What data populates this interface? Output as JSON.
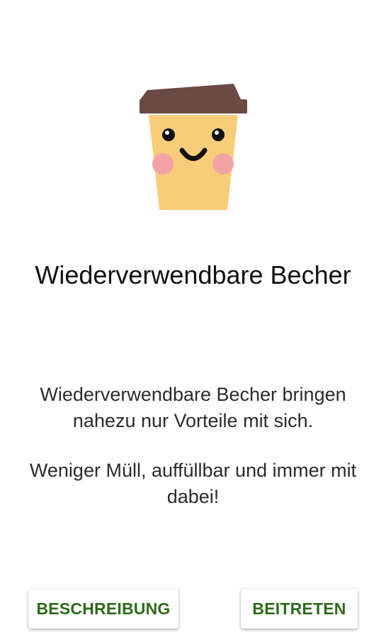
{
  "illustration": {
    "icon": "coffee-cup-face-icon",
    "colors": {
      "lid": "#6b4a43",
      "cup": "#f7cd7a",
      "cheeks": "#f4a3a5",
      "face": "#111111"
    }
  },
  "title": "Wiederverwendbare Becher",
  "description": {
    "paragraph1": "Wiederverwendbare Becher bringen nahezu nur Vorteile mit sich.",
    "paragraph2": "Weniger Müll, auffüllbar und immer mit dabei!"
  },
  "buttons": {
    "description_label": "BESCHREIBUNG",
    "join_label": "BEITRETEN"
  },
  "colors": {
    "accent": "#2e6b1a",
    "background": "#ffffff"
  }
}
